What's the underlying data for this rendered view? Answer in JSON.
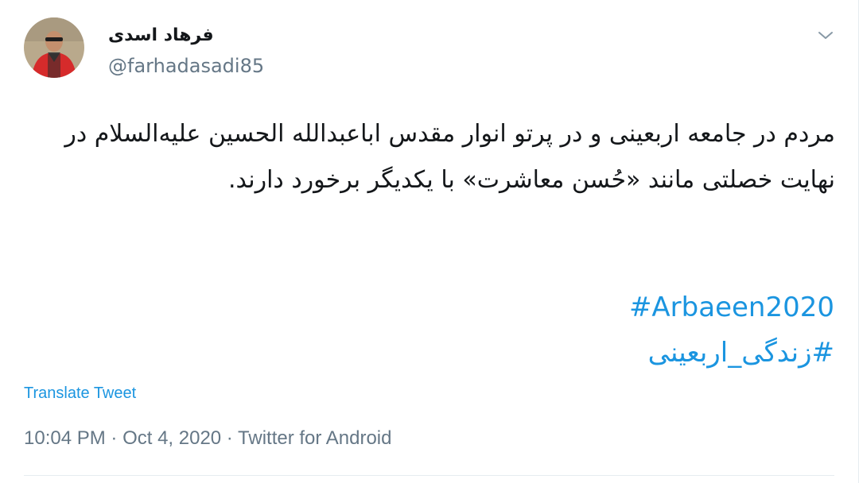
{
  "author": {
    "display_name": "فرهاد اسدی",
    "handle": "@farhadasadi85",
    "avatar_icon": "profile-photo"
  },
  "menu_icon": "chevron-down-icon",
  "tweet": {
    "text": "مردم در جامعه اربعینی و در پرتو انوار مقدس اباعبدالله الحسین علیه‌السلام در نهایت خصلتی مانند «حُسن معاشرت» با یکدیگر برخورد دارند.",
    "hashtags": [
      "#Arbaeen2020",
      "#زندگی_اربعینی"
    ],
    "translate_label": "Translate Tweet"
  },
  "meta": {
    "time": "10:04 PM",
    "separator": " · ",
    "date": "Oct 4, 2020",
    "source": "Twitter for Android"
  },
  "colors": {
    "link": "#1b95e0",
    "secondary": "#657786",
    "primary": "#14171a"
  }
}
